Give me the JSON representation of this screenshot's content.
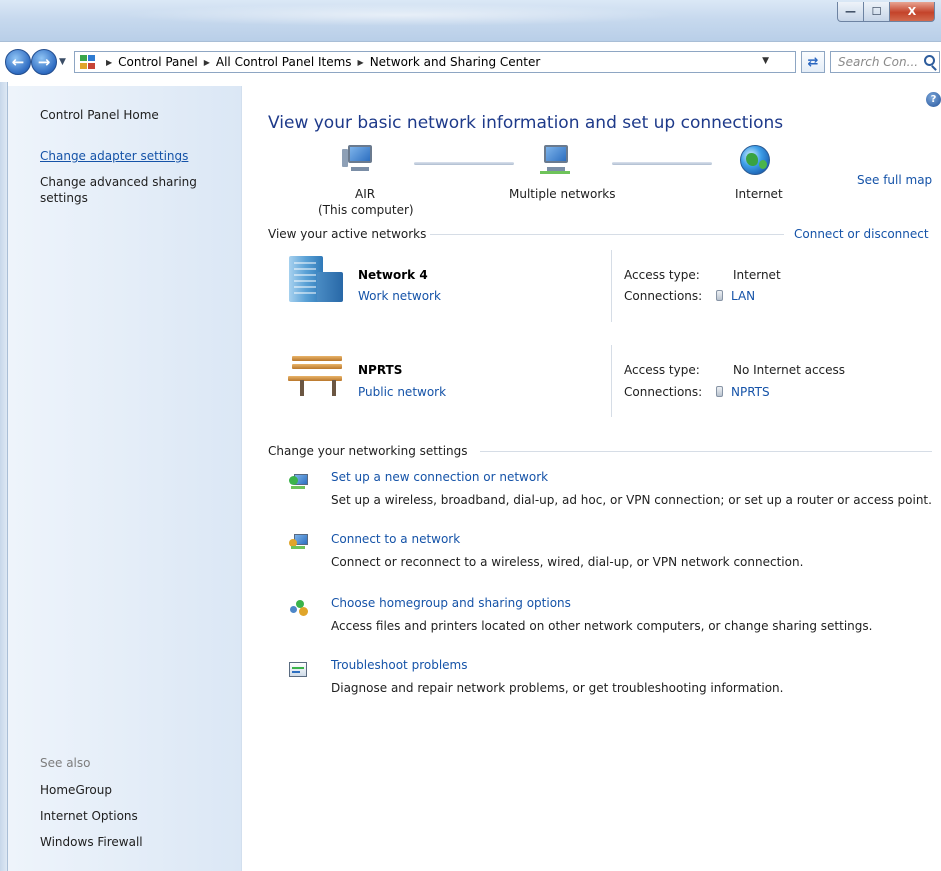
{
  "window": {
    "minimize_glyph": "—",
    "maximize_glyph": "☐",
    "close_glyph": "X"
  },
  "address": {
    "crumbs": [
      "Control Panel",
      "All Control Panel Items",
      "Network and Sharing Center"
    ],
    "search_placeholder": "Search Con..."
  },
  "left_pane": {
    "home": "Control Panel Home",
    "change_adapter": "Change adapter settings",
    "change_advanced_line1": "Change advanced sharing",
    "change_advanced_line2": "settings",
    "see_also": "See also",
    "homegroup": "HomeGroup",
    "internet_options": "Internet Options",
    "windows_firewall": "Windows Firewall"
  },
  "main": {
    "title": "View your basic network information and set up connections",
    "see_full_map": "See full map",
    "map": {
      "computer_name": "AIR",
      "computer_sub": "(This computer)",
      "middle": "Multiple networks",
      "internet": "Internet"
    },
    "active_networks_header": "View your active networks",
    "connect_or_disconnect": "Connect or disconnect",
    "networks": [
      {
        "name": "Network  4",
        "type": "Work network",
        "access_label": "Access type:",
        "access_value": "Internet",
        "conn_label": "Connections:",
        "conn_value": "LAN"
      },
      {
        "name": "NPRTS",
        "type": "Public network",
        "access_label": "Access type:",
        "access_value": "No Internet access",
        "conn_label": "Connections:",
        "conn_value": "NPRTS"
      }
    ],
    "change_settings_header": "Change your networking settings",
    "tasks": [
      {
        "title": "Set up a new connection or network",
        "desc": "Set up a wireless, broadband, dial-up, ad hoc, or VPN connection; or set up a router or access point."
      },
      {
        "title": "Connect to a network",
        "desc": "Connect or reconnect to a wireless, wired, dial-up, or VPN network connection."
      },
      {
        "title": "Choose homegroup and sharing options",
        "desc": "Access files and printers located on other network computers, or change sharing settings."
      },
      {
        "title": "Troubleshoot problems",
        "desc": "Diagnose and repair network problems, or get troubleshooting information."
      }
    ]
  },
  "help_glyph": "?"
}
